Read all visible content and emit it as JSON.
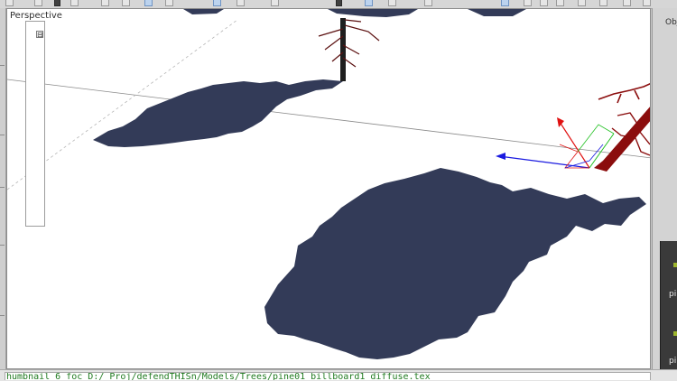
{
  "viewport": {
    "label": "Perspective",
    "background": "#ffffff",
    "shadow_color": "#333b58",
    "tree_color": "#8b0d0d",
    "gizmo_colors": {
      "x": "#e01010",
      "y": "#20c020",
      "z": "#1a1ae0"
    }
  },
  "objects_panel": {
    "header": "Obj",
    "collapse_symbol": "⊟"
  },
  "thumbnail_panel": {
    "items": [
      "pi",
      "pi"
    ]
  },
  "log": {
    "text": "humbnail 6 foc D:/ Proj/defendTHISn/Models/Trees/pine01 billboard1 diffuse.tex"
  }
}
